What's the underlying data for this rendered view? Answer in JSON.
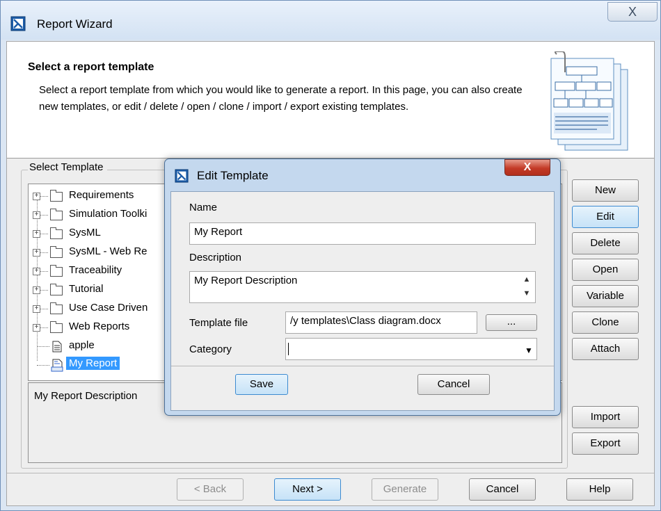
{
  "window": {
    "title": "Report Wizard",
    "close_label": "X"
  },
  "header": {
    "title": "Select a report template",
    "description": "Select a report template from which you would like to generate a report. In this page, you can also create new templates, or edit / delete / open / clone / import / export existing templates."
  },
  "select_template": {
    "legend": "Select Template",
    "tree": [
      {
        "label": "Requirements",
        "type": "folder"
      },
      {
        "label": "Simulation Toolki",
        "type": "folder"
      },
      {
        "label": "SysML",
        "type": "folder"
      },
      {
        "label": "SysML - Web Re",
        "type": "folder"
      },
      {
        "label": "Traceability",
        "type": "folder"
      },
      {
        "label": "Tutorial",
        "type": "folder"
      },
      {
        "label": "Use Case Driven",
        "type": "folder"
      },
      {
        "label": "Web Reports",
        "type": "folder"
      },
      {
        "label": "apple",
        "type": "document"
      },
      {
        "label": "My Report",
        "type": "report",
        "selected": true
      }
    ],
    "description": "My Report Description"
  },
  "side_buttons": {
    "new": "New",
    "edit": "Edit",
    "delete": "Delete",
    "open": "Open",
    "variable": "Variable",
    "clone": "Clone",
    "attach": "Attach",
    "import": "Import",
    "export": "Export"
  },
  "footer_buttons": {
    "back": "< Back",
    "next": "Next >",
    "generate": "Generate",
    "cancel": "Cancel",
    "help": "Help"
  },
  "edit_dialog": {
    "title": "Edit Template",
    "close_label": "X",
    "name_label": "Name",
    "name_value": "My Report",
    "description_label": "Description",
    "description_value": "My Report Description",
    "template_file_label": "Template file",
    "template_file_value": "/y templates\\Class diagram.docx",
    "browse_label": "...",
    "category_label": "Category",
    "category_value": "",
    "save": "Save",
    "cancel": "Cancel"
  },
  "colors": {
    "accent": "#3399ff",
    "selection": "#3399ff",
    "dialog_frame": "#c4d8ee",
    "close_red": "#c33a26"
  },
  "icons": {
    "app": "report-wizard-icon",
    "folder": "folder-icon",
    "document": "document-icon",
    "report": "report-template-icon"
  }
}
